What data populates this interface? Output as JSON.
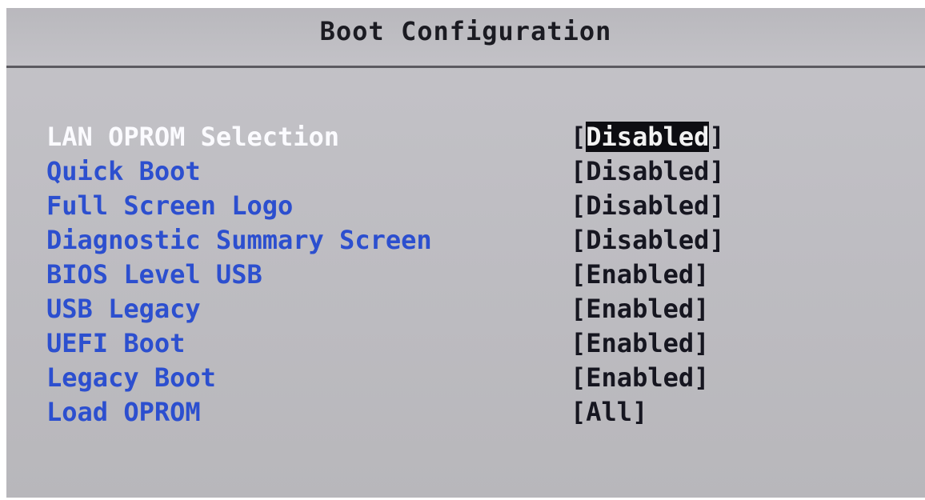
{
  "header": {
    "title": "Boot Configuration"
  },
  "items": [
    {
      "label": "LAN OPROM Selection",
      "value": "Disabled",
      "selected": true
    },
    {
      "label": "Quick Boot",
      "value": "Disabled",
      "selected": false
    },
    {
      "label": "Full Screen Logo",
      "value": "Disabled",
      "selected": false
    },
    {
      "label": "Diagnostic Summary Screen",
      "value": "Disabled",
      "selected": false
    },
    {
      "label": "BIOS Level USB",
      "value": "Enabled",
      "selected": false
    },
    {
      "label": "USB Legacy",
      "value": "Enabled",
      "selected": false
    },
    {
      "label": "UEFI Boot",
      "value": "Enabled",
      "selected": false
    },
    {
      "label": "Legacy Boot",
      "value": "Enabled",
      "selected": false
    },
    {
      "label": "Load OPROM",
      "value": "All",
      "selected": false
    }
  ],
  "colors": {
    "item_label": "#2c4fcf",
    "selected_label": "#fbfbff",
    "value_text": "#161620",
    "highlight_bg": "#0d0d12",
    "background": "#c0bfc4"
  }
}
